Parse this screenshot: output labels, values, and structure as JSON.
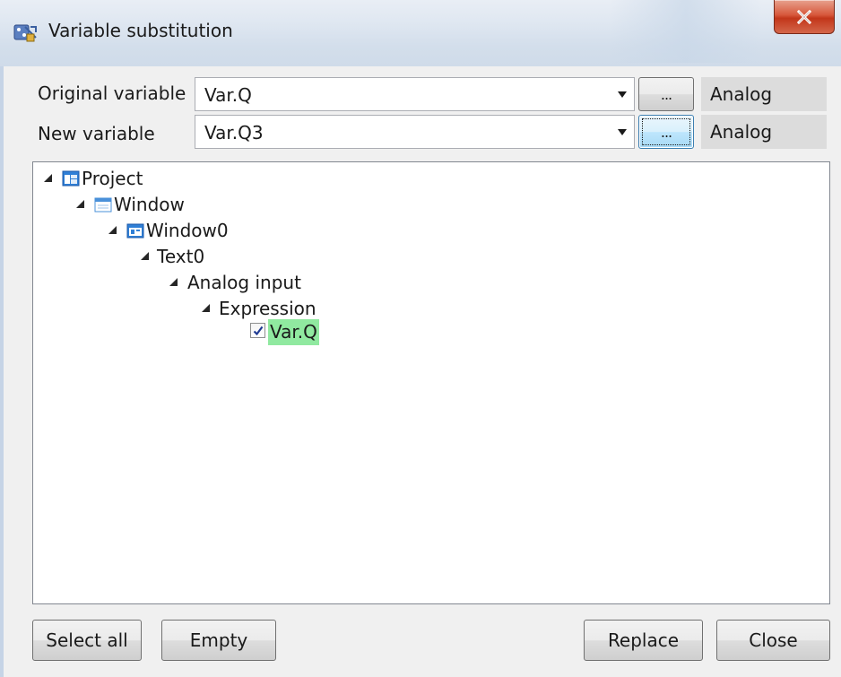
{
  "window": {
    "title": "Variable substitution",
    "app_icon": "variable-substitution-app-icon",
    "close_icon": "close-icon"
  },
  "form": {
    "original_variable": {
      "label": "Original variable",
      "value": "Var.Q",
      "browse_label": "...",
      "type": "Analog"
    },
    "new_variable": {
      "label": "New variable",
      "value": "Var.Q3",
      "browse_label": "...",
      "type": "Analog"
    }
  },
  "tree": {
    "nodes": [
      {
        "label": "Project",
        "icon": "project-icon",
        "expanded": true
      },
      {
        "label": "Window",
        "icon": "window-folder-icon",
        "expanded": true
      },
      {
        "label": "Window0",
        "icon": "window-screen-icon",
        "expanded": true
      },
      {
        "label": "Text0",
        "expanded": true
      },
      {
        "label": "Analog input",
        "expanded": true
      },
      {
        "label": "Expression",
        "expanded": true
      },
      {
        "label": "Var.Q",
        "checked": true,
        "highlight_color": "#90e9a0"
      }
    ]
  },
  "buttons": {
    "select_all": "Select all",
    "empty": "Empty",
    "replace": "Replace",
    "close": "Close"
  },
  "colors": {
    "highlight": "#90e9a0",
    "close_button": "#c7432a",
    "focus_border": "#3c7fb1"
  }
}
